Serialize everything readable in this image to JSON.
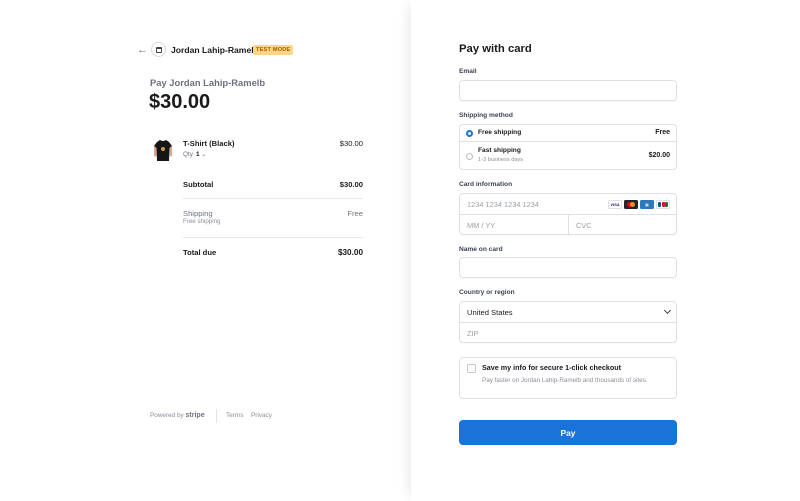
{
  "merchant": {
    "name": "Jordan Lahip-Ramelb",
    "mode_badge": "TEST MODE"
  },
  "summary": {
    "pay_to": "Pay Jordan Lahip-Ramelb",
    "amount": "$30.00",
    "item": {
      "name": "T-Shirt (Black)",
      "qty_label": "Qty",
      "qty_value": "1",
      "price": "$30.00"
    },
    "subtotal_label": "Subtotal",
    "subtotal_value": "$30.00",
    "shipping_label": "Shipping",
    "shipping_sub": "Free shipping",
    "shipping_value": "Free",
    "total_label": "Total due",
    "total_value": "$30.00"
  },
  "footer": {
    "powered_prefix": "Powered by",
    "powered_brand": "stripe",
    "terms": "Terms",
    "privacy": "Privacy"
  },
  "form": {
    "title": "Pay with card",
    "email_label": "Email",
    "email_value": "",
    "shipping_method_label": "Shipping method",
    "shipping_options": [
      {
        "name": "Free shipping",
        "sub": "",
        "price": "Free",
        "selected": true
      },
      {
        "name": "Fast shipping",
        "sub": "1-3 business days",
        "price": "$20.00",
        "selected": false
      }
    ],
    "card_label": "Card information",
    "card_number_placeholder": "1234 1234 1234 1234",
    "expiry_placeholder": "MM / YY",
    "cvc_placeholder": "CVC",
    "card_brands": [
      "visa-icon",
      "mastercard-icon",
      "amex-icon",
      "jcb-icon"
    ],
    "name_label": "Name on card",
    "name_value": "",
    "country_label": "Country or region",
    "country_value": "United States",
    "zip_placeholder": "ZIP",
    "save_title": "Save my info for secure 1-click checkout",
    "save_desc": "Pay faster on Jordan Lahip-Ramelb and thousands of sites.",
    "pay_button": "Pay"
  },
  "colors": {
    "accent": "#1a73d8",
    "badge_bg": "#ffd485",
    "badge_text": "#a15d00"
  }
}
